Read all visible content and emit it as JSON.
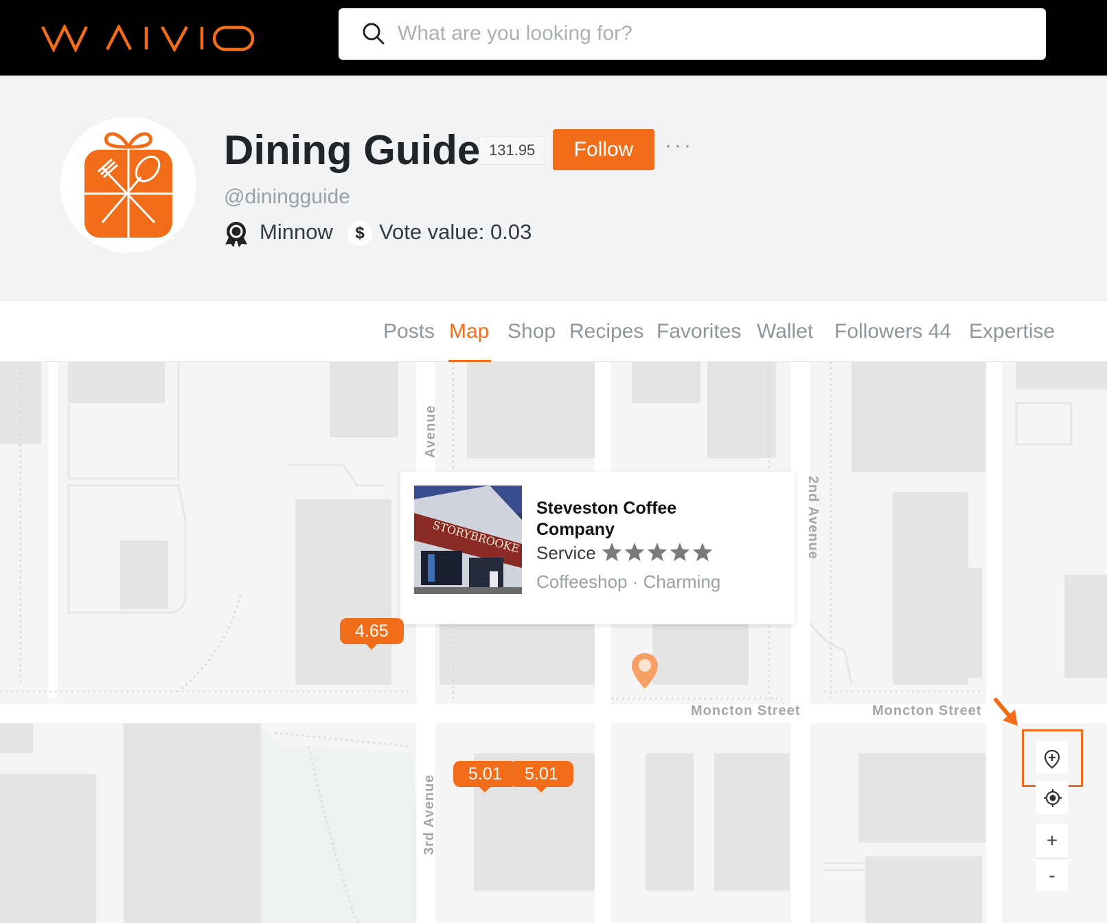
{
  "brand": {
    "logo_text": "WAIVIO",
    "accent_color": "#f26d1a"
  },
  "search": {
    "placeholder": "What are you looking for?",
    "icon": "search-icon"
  },
  "profile": {
    "name": "Dining Guide",
    "score": "131.95",
    "follow_label": "Follow",
    "more_label": "···",
    "handle": "@diningguide",
    "rank": "Minnow",
    "rank_icon": "award-icon",
    "vote_icon": "dollar-icon",
    "vote_value": "Vote value: 0.03"
  },
  "tabs": [
    {
      "label": "Posts"
    },
    {
      "label": "Map",
      "active": true
    },
    {
      "label": "Shop"
    },
    {
      "label": "Recipes"
    },
    {
      "label": "Favorites"
    },
    {
      "label": "Wallet"
    },
    {
      "label": "Followers 44"
    },
    {
      "label": "Expertise"
    }
  ],
  "map": {
    "streets": {
      "moncton_1": "Moncton Street",
      "moncton_2": "Moncton Street",
      "avenue_top": "Avenue",
      "second_avenue": "2nd Avenue",
      "third_avenue": "3rd Avenue"
    },
    "popup": {
      "name": "Steveston Coffee Company",
      "service_label": "Service",
      "rating": 5,
      "tags": "Coffeeshop · Charming",
      "image_alt": "storefront-photo",
      "sign_text": "STORYBROOKE"
    },
    "markers": [
      {
        "label": "4.65"
      },
      {
        "label": "5.01"
      },
      {
        "label": "5.01"
      }
    ],
    "controls": {
      "add_place_icon": "map-pin-plus-icon",
      "locate_icon": "locate-icon",
      "zoom_in": "+",
      "zoom_out": "-"
    }
  }
}
